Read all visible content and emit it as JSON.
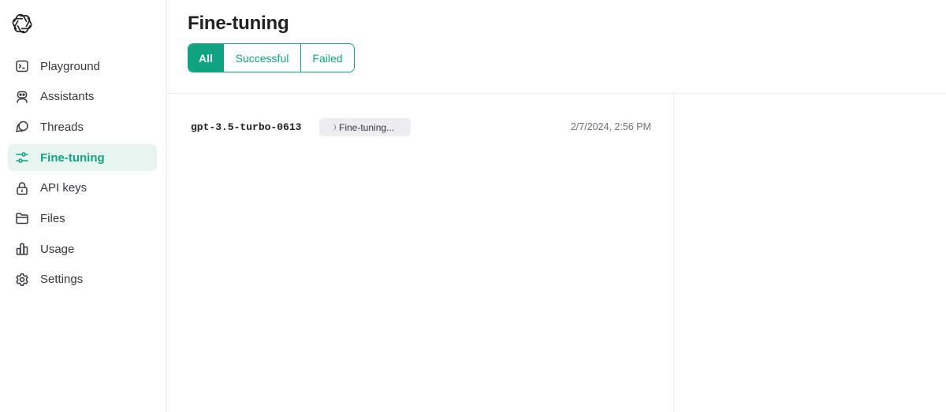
{
  "sidebar": {
    "logo": "openai-logo",
    "items": [
      {
        "label": "Playground",
        "icon": "terminal-icon",
        "active": false
      },
      {
        "label": "Assistants",
        "icon": "robot-icon",
        "active": false
      },
      {
        "label": "Threads",
        "icon": "chat-bubbles-icon",
        "active": false
      },
      {
        "label": "Fine-tuning",
        "icon": "sliders-icon",
        "active": true
      },
      {
        "label": "API keys",
        "icon": "lock-icon",
        "active": false
      },
      {
        "label": "Files",
        "icon": "folder-icon",
        "active": false
      },
      {
        "label": "Usage",
        "icon": "bar-chart-icon",
        "active": false
      },
      {
        "label": "Settings",
        "icon": "gear-icon",
        "active": false
      }
    ]
  },
  "main": {
    "title": "Fine-tuning",
    "filters": [
      {
        "label": "All",
        "selected": true
      },
      {
        "label": "Successful",
        "selected": false
      },
      {
        "label": "Failed",
        "selected": false
      }
    ],
    "jobs": [
      {
        "model": "gpt-3.5-turbo-0613",
        "status": "Fine-tuning...",
        "timestamp": "2/7/2024, 2:56 PM"
      }
    ]
  },
  "colors": {
    "accent": "#10a37f",
    "active_bg": "#e8f4f0",
    "text": "#202123",
    "muted": "#6e6e80",
    "pill_bg": "#ececf1"
  }
}
